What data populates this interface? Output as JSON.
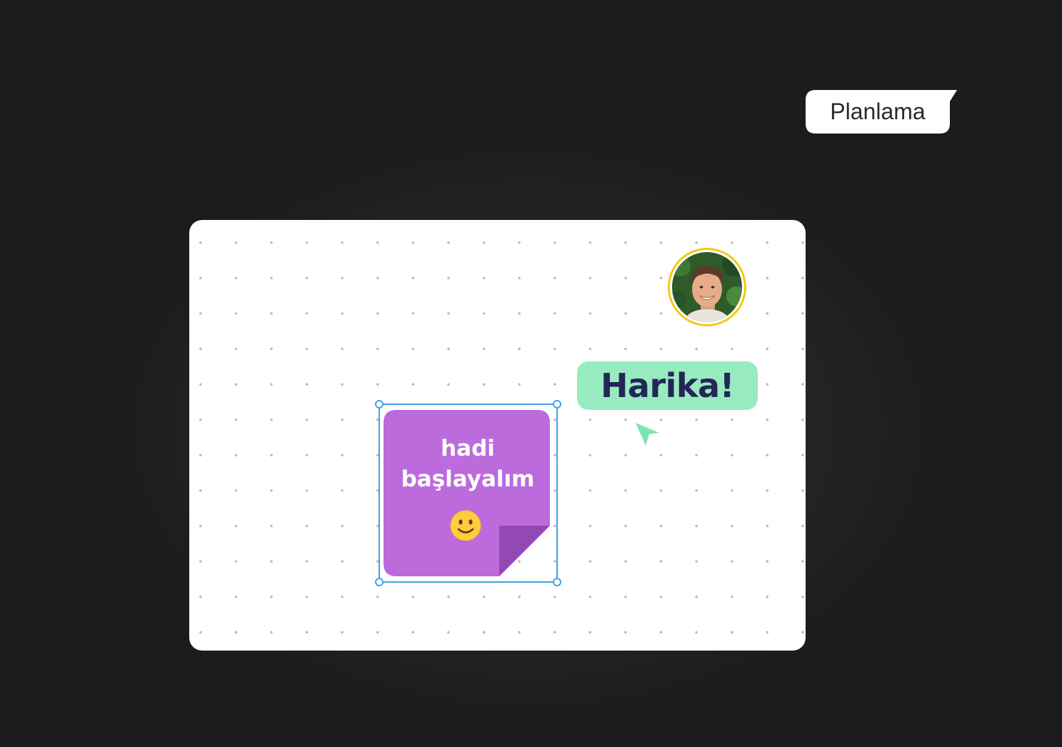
{
  "tag": {
    "label": "Planlama"
  },
  "board": {
    "avatar": {
      "ring_color": "#f2c919",
      "icon": "user-avatar"
    },
    "reaction": {
      "text": "Harika!",
      "background": "#98ebbf",
      "text_color": "#232657"
    },
    "cursor": {
      "icon": "pointer-arrow-icon",
      "color": "#7ee4ae"
    },
    "sticky_note": {
      "line1": "hadi",
      "line2": "başlayalım",
      "emoji": "smiley-face-icon",
      "color": "#bb6bdb",
      "fold_color": "#9448b6",
      "selected": true,
      "selection_color": "#3fa3e6"
    }
  }
}
